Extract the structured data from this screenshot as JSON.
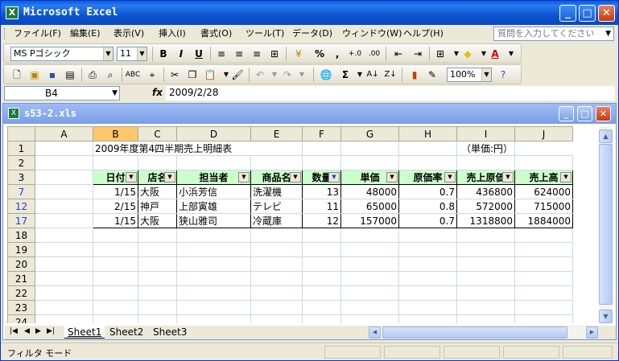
{
  "app": {
    "title": "Microsoft Excel",
    "icon": "excel-icon"
  },
  "menu": {
    "items": [
      "ファイル(F)",
      "編集(E)",
      "表示(V)",
      "挿入(I)",
      "書式(O)",
      "ツール(T)",
      "データ(D)",
      "ウィンドウ(W)",
      "ヘルプ(H)"
    ],
    "ask_placeholder": "質問を入力してください"
  },
  "format_toolbar": {
    "font_name": "MS Pゴシック",
    "font_size": "11",
    "bold": "B",
    "italic": "I",
    "underline": "U",
    "percent": "%",
    "comma": ","
  },
  "standard_toolbar": {
    "zoom": "100%",
    "sum": "Σ"
  },
  "formula_bar": {
    "name_box": "B4",
    "fx": "fx",
    "formula": "2009/2/28"
  },
  "workbook": {
    "title": "s53-2.xls"
  },
  "sheet": {
    "columns": [
      "A",
      "B",
      "C",
      "D",
      "E",
      "F",
      "G",
      "H",
      "I",
      "J"
    ],
    "selected_column": "B",
    "title_row": {
      "row": "1",
      "title": "2009年度第4四半期売上明細表",
      "unit": "（単価:円）"
    },
    "header_row": {
      "row": "3",
      "cells": [
        "日付",
        "店名",
        "担当者",
        "商品名",
        "数量",
        "単価",
        "原価率",
        "売上原価",
        "売上高"
      ]
    },
    "data_rows": [
      {
        "row": "7",
        "cells": [
          "1/15",
          "大阪",
          "小浜芳信",
          "洗濯機",
          "13",
          "48000",
          "0.7",
          "436800",
          "624000"
        ]
      },
      {
        "row": "12",
        "cells": [
          "2/15",
          "神戸",
          "上部寅雄",
          "テレビ",
          "11",
          "65000",
          "0.8",
          "572000",
          "715000"
        ]
      },
      {
        "row": "17",
        "cells": [
          "1/15",
          "大阪",
          "狭山雅司",
          "冷蔵庫",
          "12",
          "157000",
          "0.7",
          "1318800",
          "1884000"
        ]
      }
    ],
    "empty_rows": [
      "2",
      "18",
      "19",
      "20",
      "21",
      "22",
      "23",
      "24"
    ]
  },
  "tabs": [
    "Sheet1",
    "Sheet2",
    "Sheet3"
  ],
  "status": {
    "text": "フィルタ モード"
  }
}
